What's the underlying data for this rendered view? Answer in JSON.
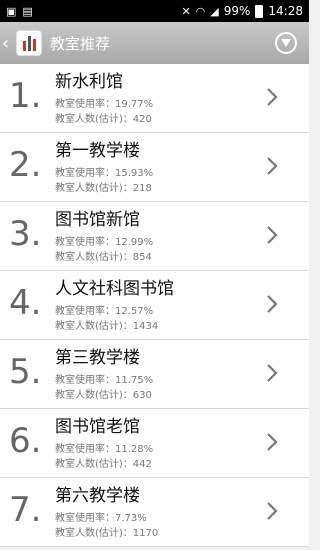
{
  "status_bar": {
    "battery": "99%",
    "time": "14:28",
    "icons": [
      "image-icon",
      "notification-icon",
      "mute-icon",
      "wifi-icon",
      "signal-icon",
      "battery-icon"
    ]
  },
  "app_bar": {
    "back": "‹",
    "title": "教室推荐",
    "icons": [
      "app-logo-icon",
      "dropdown-menu-icon"
    ]
  },
  "list": {
    "items": [
      {
        "rank": "1.",
        "name": "新水利馆",
        "usage_text": "教室使用率：19.77%",
        "people_text": "教室人数(估计)：420"
      },
      {
        "rank": "2.",
        "name": "第一教学楼",
        "usage_text": "教室使用率：15.93%",
        "people_text": "教室人数(估计)：218"
      },
      {
        "rank": "3.",
        "name": "图书馆新馆",
        "usage_text": "教室使用率：12.99%",
        "people_text": "教室人数(估计)：854"
      },
      {
        "rank": "4.",
        "name": "人文社科图书馆",
        "usage_text": "教室使用率：12.57%",
        "people_text": "教室人数(估计)：1434"
      },
      {
        "rank": "5.",
        "name": "第三教学楼",
        "usage_text": "教室使用率：11.75%",
        "people_text": "教室人数(估计)：630"
      },
      {
        "rank": "6.",
        "name": "图书馆老馆",
        "usage_text": "教室使用率：11.28%",
        "people_text": "教室人数(估计)：442"
      },
      {
        "rank": "7.",
        "name": "第六教学楼",
        "usage_text": "教室使用率：7.73%",
        "people_text": "教室人数(估计)：1170"
      }
    ]
  },
  "colors": {
    "app_bar": "#b8b8b8",
    "status_bar": "#000000",
    "row_background": "#ffffff",
    "divider": "#d8d8d8"
  }
}
